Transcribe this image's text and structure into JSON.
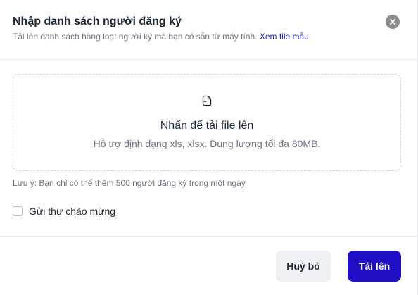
{
  "modal": {
    "title": "Nhập danh sách người đăng ký",
    "subtitle": "Tải lên danh sách hàng loạt người ký mà bạn có sẵn từ máy tính.",
    "sample_link": "Xem file mẫu",
    "close_icon": "close-icon"
  },
  "dropzone": {
    "icon": "file-upload-icon",
    "title": "Nhấn để tải file lên",
    "hint": "Hỗ trợ định dạng xls, xlsx. Dung lượng tối đa 80MB."
  },
  "note": "Lưu ý: Bạn chỉ có thể thêm 500 người đăng ký trong một ngày",
  "welcome_checkbox": {
    "label": "Gửi thư chào mừng",
    "checked": false
  },
  "footer": {
    "cancel_label": "Huỷ bỏ",
    "upload_label": "Tải lên"
  },
  "colors": {
    "primary": "#1f0fc4",
    "link": "#2320c9",
    "close_bg": "#8b8b8b"
  }
}
